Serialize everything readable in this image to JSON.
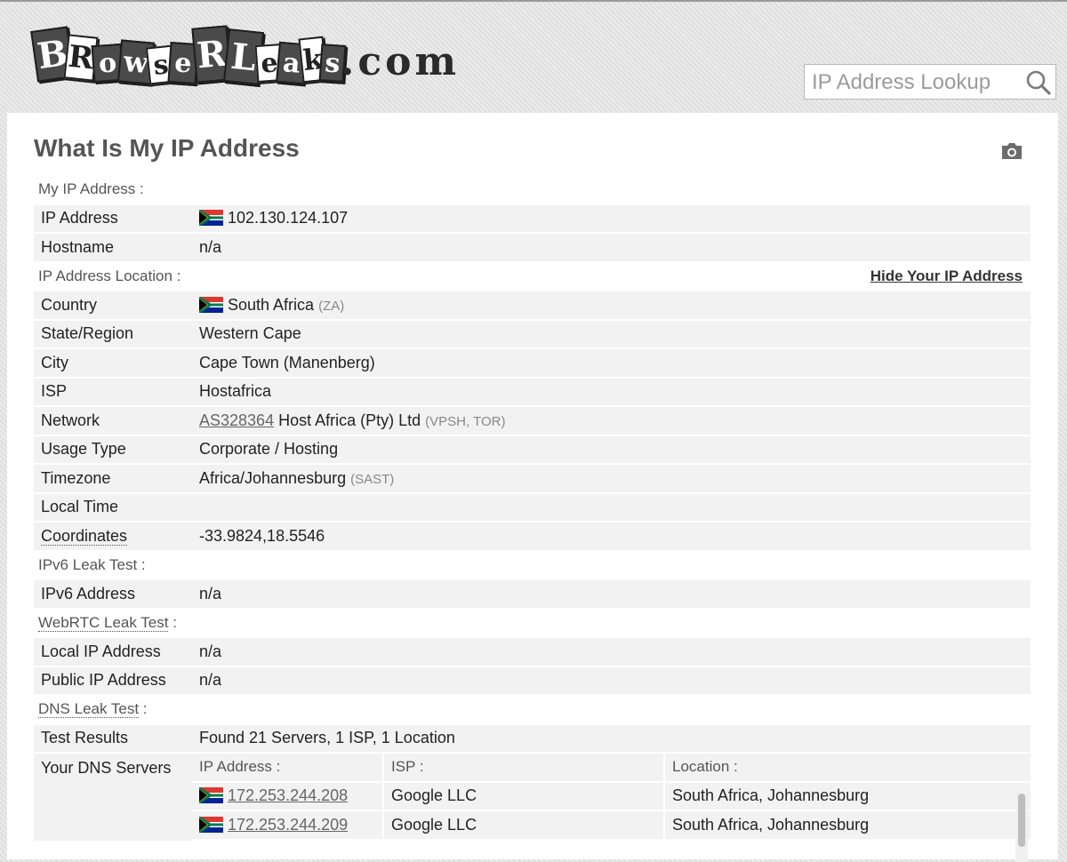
{
  "logo": {
    "alt": "BrowserLeaks.com",
    "tiles": [
      "B",
      "R",
      "o",
      "w",
      "s",
      "e",
      "R",
      "L",
      "e",
      "a",
      "k",
      "s"
    ],
    "tail": ".com"
  },
  "search": {
    "placeholder": "IP Address Lookup"
  },
  "page": {
    "title": "What Is My IP Address"
  },
  "sections": {
    "my_ip": {
      "heading": "My IP Address :",
      "rows": [
        {
          "key": "IP Address",
          "value": "102.130.124.107",
          "flag": "za"
        },
        {
          "key": "Hostname",
          "value": "n/a"
        }
      ]
    },
    "location": {
      "heading": "IP Address Location :",
      "hide_link": "Hide Your IP Address",
      "country": {
        "key": "Country",
        "value": "South Africa",
        "code": "(ZA)"
      },
      "state": {
        "key": "State/Region",
        "value": "Western Cape"
      },
      "city": {
        "key": "City",
        "value": "Cape Town (Manenberg)"
      },
      "isp": {
        "key": "ISP",
        "value": "Hostafrica"
      },
      "network": {
        "key": "Network",
        "asn": "AS328364",
        "name": "Host Africa (Pty) Ltd",
        "tags": "(VPSH, TOR)"
      },
      "usage": {
        "key": "Usage Type",
        "value": "Corporate / Hosting"
      },
      "timezone": {
        "key": "Timezone",
        "value": "Africa/Johannesburg",
        "abbr": "(SAST)"
      },
      "local_time": {
        "key": "Local Time",
        "value": ""
      },
      "coordinates": {
        "key": "Coordinates",
        "value": "-33.9824,18.5546"
      }
    },
    "ipv6": {
      "heading": "IPv6 Leak Test :",
      "row": {
        "key": "IPv6 Address",
        "value": "n/a"
      }
    },
    "webrtc": {
      "heading_link": "WebRTC Leak Test",
      "heading_suffix": " :",
      "local": {
        "key": "Local IP Address",
        "value": "n/a"
      },
      "public": {
        "key": "Public IP Address",
        "value": "n/a"
      }
    },
    "dns": {
      "heading_link": "DNS Leak Test",
      "heading_suffix": " :",
      "results": {
        "key": "Test Results",
        "value": "Found 21 Servers, 1 ISP, 1 Location"
      },
      "servers_key": "Your DNS Servers",
      "columns": [
        "IP Address :",
        "ISP :",
        "Location :"
      ],
      "servers": [
        {
          "ip": "172.253.244.208",
          "isp": "Google LLC",
          "location": "South Africa, Johannesburg"
        },
        {
          "ip": "172.253.244.209",
          "isp": "Google LLC",
          "location": "South Africa, Johannesburg"
        }
      ]
    }
  },
  "colors": {
    "flag_green": "#007a4d",
    "flag_red": "#de3831",
    "flag_blue": "#002395",
    "flag_gold": "#ffb612",
    "title_gray": "#555555",
    "row_bg": "#f2f2f2"
  },
  "icons": [
    "search-icon",
    "camera-icon",
    "south-africa-flag-icon"
  ]
}
